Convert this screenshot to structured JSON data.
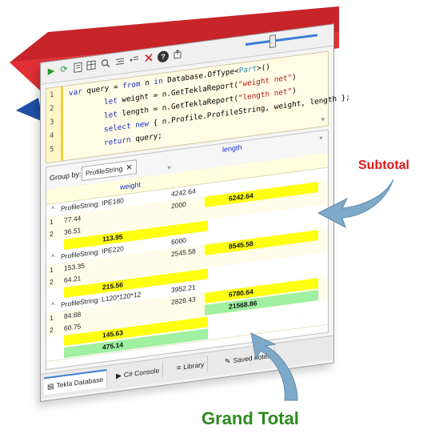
{
  "toolbar": {
    "buttons": [
      "run-icon",
      "refresh-icon",
      "document-icon",
      "table-icon",
      "search-icon",
      "format-icon",
      "indent-icon",
      "cancel-icon",
      "help-icon",
      "export-icon"
    ],
    "play_glyph": "▶",
    "refresh_glyph": "⟳",
    "help_glyph": "?"
  },
  "editor": {
    "line_numbers": [
      "1",
      "2",
      "3",
      "4",
      "5"
    ],
    "lines": [
      {
        "kw1": "var",
        "t1": " query = ",
        "kw2": "from",
        "t2": " n ",
        "kw3": "in",
        "t3": " Database.OfType<",
        "type": "Part",
        "t4": ">()"
      },
      {
        "kw1": "let",
        "t1": " weight = n.GetTeklaReport(",
        "str": "\"weight net\"",
        "t2": ")"
      },
      {
        "kw1": "let",
        "t1": " length = n.GetTeklaReport(",
        "str": "\"length net\"",
        "t2": ")"
      },
      {
        "kw1": "select",
        "t1": " ",
        "kw2": "new",
        "t2": " { n.Profile.ProfileString, weight, length };"
      },
      {
        "kw1": "return",
        "t1": " query;"
      }
    ]
  },
  "grid": {
    "group_by_label": "Group by:",
    "group_chip": "ProfileString",
    "chip_close": "✕",
    "col_weight": "weight",
    "col_length": "length",
    "groups": [
      {
        "label": "ProfileString: IPE180",
        "rows": [
          {
            "n": "1",
            "w": "77.44",
            "l": "4242.64"
          },
          {
            "n": "2",
            "w": "36.51",
            "l": "2000"
          }
        ],
        "sub_w": "113.95",
        "sub_l": "6242.64"
      },
      {
        "label": "ProfileString: IPE220",
        "rows": [
          {
            "n": "1",
            "w": "153.35",
            "l": "6000"
          },
          {
            "n": "2",
            "w": "64.21",
            "l": "2545.58"
          }
        ],
        "sub_w": "215.56",
        "sub_l": "8545.58"
      },
      {
        "label": "ProfileString: L120*120*12",
        "rows": [
          {
            "n": "1",
            "w": "84.88",
            "l": "3952.21"
          },
          {
            "n": "2",
            "w": "60.75",
            "l": "2828.43"
          }
        ],
        "sub_w": "145.63",
        "sub_l": "6780.64"
      }
    ],
    "grand_w": "475.14",
    "grand_l": "21568.86"
  },
  "tabs": [
    {
      "label": "Tekla Database",
      "icon": "database-icon",
      "active": true
    },
    {
      "label": "C# Console",
      "icon": "console-icon",
      "active": false
    },
    {
      "label": "Library",
      "icon": "library-icon",
      "active": false
    },
    {
      "label": "Saved notes",
      "icon": "notes-icon",
      "active": false
    }
  ],
  "annotations": {
    "subtotal": "Subtotal",
    "grand_total": "Grand Total"
  },
  "colors": {
    "highlight_yellow": "#ffff10",
    "highlight_green": "#9ff0a0",
    "red_banner": "#d9262b",
    "arrow_blue": "#7fa9c9",
    "subtotal_text": "#e01818",
    "grand_total_text": "#2e8a1e"
  }
}
